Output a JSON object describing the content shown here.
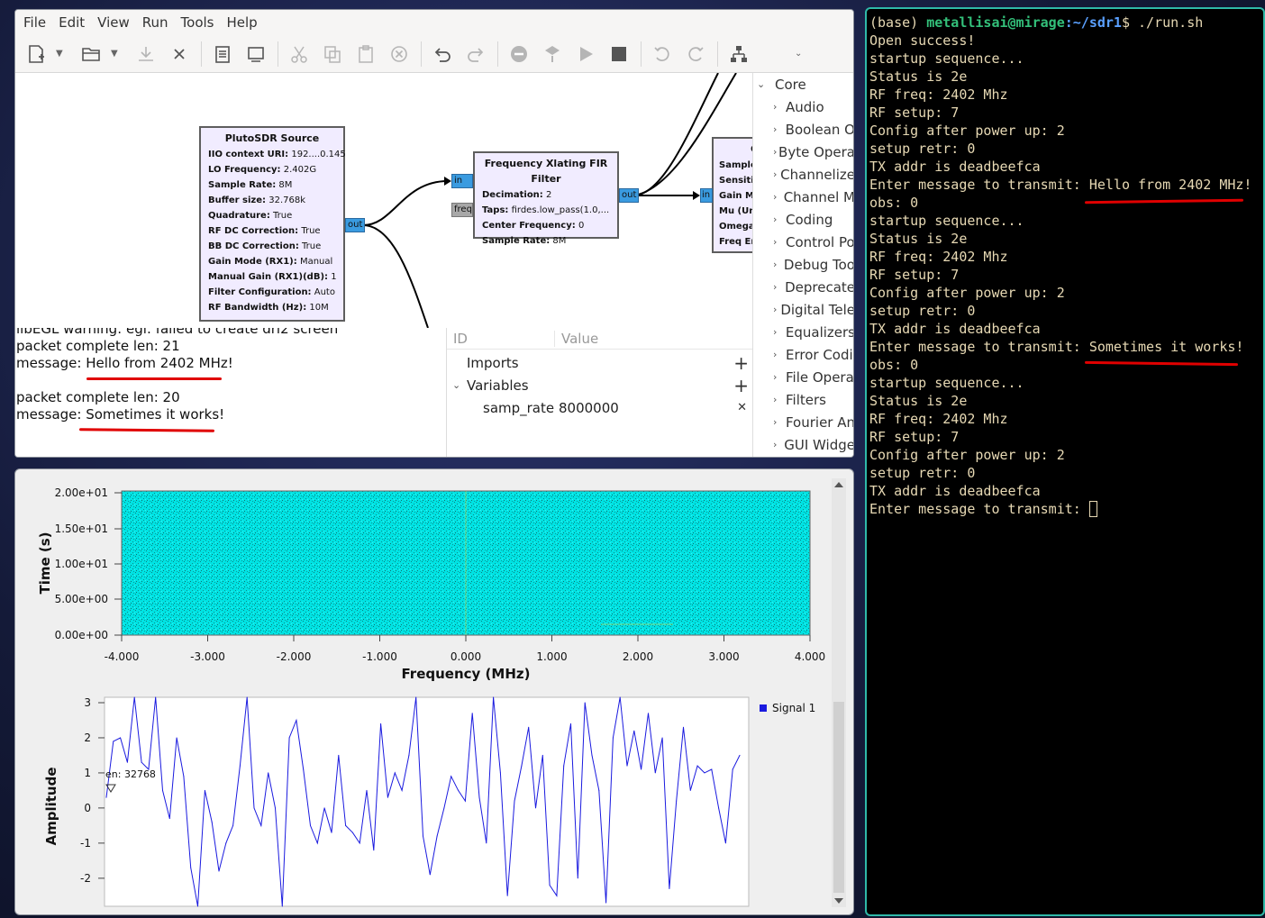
{
  "grc": {
    "menu": [
      "File",
      "Edit",
      "View",
      "Run",
      "Tools",
      "Help"
    ],
    "blocks": {
      "pluto": {
        "title": "PlutoSDR Source",
        "params": [
          {
            "k": "IIO context URI:",
            "v": "192....0.145"
          },
          {
            "k": "LO Frequency:",
            "v": "2.402G"
          },
          {
            "k": "Sample Rate:",
            "v": "8M"
          },
          {
            "k": "Buffer size:",
            "v": "32.768k"
          },
          {
            "k": "Quadrature:",
            "v": "True"
          },
          {
            "k": "RF DC Correction:",
            "v": "True"
          },
          {
            "k": "BB DC Correction:",
            "v": "True"
          },
          {
            "k": "Gain Mode (RX1):",
            "v": "Manual"
          },
          {
            "k": "Manual Gain (RX1)(dB):",
            "v": "1"
          },
          {
            "k": "Filter Configuration:",
            "v": "Auto"
          },
          {
            "k": "RF Bandwidth (Hz):",
            "v": "10M"
          }
        ],
        "out_port": "out"
      },
      "fir": {
        "title": "Frequency Xlating FIR Filter",
        "params": [
          {
            "k": "Decimation:",
            "v": "2"
          },
          {
            "k": "Taps:",
            "v": "firdes.low_pass(1.0,..."
          },
          {
            "k": "Center Frequency:",
            "v": "0"
          },
          {
            "k": "Sample Rate:",
            "v": "8M"
          }
        ],
        "in_port": "in",
        "freq_port": "freq",
        "out_port": "out"
      },
      "gfsk": {
        "title": "G",
        "params": [
          "Sample",
          "Sensitiv",
          "Gain Mu",
          "Mu (Un",
          "Omega",
          "Freq Err"
        ],
        "in_port": "in"
      }
    },
    "sidebar": {
      "root": "Core",
      "items": [
        "Audio",
        "Boolean O",
        "Byte Opera",
        "Channelize",
        "Channel M",
        "Coding",
        "Control Po",
        "Debug Too",
        "Deprecate",
        "Digital Tele",
        "Equalizers",
        "Error Codi",
        "File Opera",
        "Filters",
        "Fourier An",
        "GUI Widge"
      ]
    },
    "console": {
      "cut_line": "libEGL warning: egl: failed to create dri2 screen",
      "lines": [
        "packet complete len: 21",
        "message: Hello from 2402 MHz!",
        "",
        "packet complete len: 20",
        "message: Sometimes it works!"
      ]
    },
    "variables": {
      "col_id": "ID",
      "col_value": "Value",
      "imports": "Imports",
      "variables": "Variables",
      "var_name": "samp_rate",
      "var_value": "8000000"
    }
  },
  "qt": {
    "waterfall": {
      "ylabel": "Time (s)",
      "xlabel": "Frequency (MHz)",
      "yticks": [
        "2.00e+01",
        "1.50e+01",
        "1.00e+01",
        "5.00e+00",
        "0.00e+00"
      ],
      "xticks": [
        "-4.000",
        "-3.000",
        "-2.000",
        "-1.000",
        "0.000",
        "1.000",
        "2.000",
        "3.000",
        "4.000"
      ],
      "color": "#00e0e0"
    },
    "timeplot": {
      "ylabel": "Amplitude",
      "yticks": [
        "3",
        "2",
        "1",
        "0",
        "-1",
        "-2"
      ],
      "legend": "Signal 1",
      "marker_label": "en: 32768",
      "line_color": "#1a1adf"
    }
  },
  "chart_data": {
    "type": "line",
    "title": "",
    "xlabel": "",
    "ylabel": "Amplitude",
    "ylim": [
      -2.8,
      3
    ],
    "series": [
      {
        "name": "Signal 1",
        "values": [
          0.3,
          1.9,
          2.0,
          1.3,
          3.4,
          1.3,
          1.1,
          3.6,
          0.5,
          -0.3,
          2.0,
          0.9,
          -1.7,
          -3.2,
          0.5,
          -0.4,
          -1.8,
          -1.0,
          -0.5,
          1.2,
          3.5,
          0.0,
          -0.5,
          1.0,
          0.0,
          -3.0,
          2.0,
          2.5,
          1.1,
          -0.5,
          -1.0,
          0.0,
          -0.7,
          1.5,
          -0.5,
          -0.7,
          -1.0,
          0.5,
          -1.2,
          2.4,
          0.3,
          1.0,
          0.5,
          1.5,
          3.8,
          -0.8,
          -1.9,
          -0.8,
          0.0,
          0.9,
          0.5,
          0.2,
          2.7,
          0.3,
          -1.0,
          3.3,
          1.0,
          -2.5,
          0.2,
          1.2,
          2.3,
          0.0,
          1.5,
          -2.2,
          -2.5,
          1.2,
          2.4,
          -2.0,
          3.0,
          1.5,
          0.5,
          -2.7,
          2.0,
          3.4,
          1.2,
          2.2,
          1.1,
          2.7,
          1.0,
          2.0,
          -2.3,
          0.2,
          2.3,
          0.5,
          1.2,
          1.0,
          1.1,
          0.0,
          -1.0,
          1.1,
          1.5
        ]
      }
    ]
  },
  "terminal": {
    "prompt_prefix": "(base) ",
    "user_host": "metallisai@mirage",
    "path": ":~/sdr1",
    "command": "$ ./run.sh",
    "lines": [
      "Open success!",
      "startup sequence...",
      "Status is 2e",
      "RF freq: 2402 Mhz",
      "RF setup: 7",
      "Config after power up: 2",
      "setup retr: 0",
      "TX addr is deadbeefca",
      "Enter message to transmit: Hello from 2402 MHz!",
      "obs: 0",
      "startup sequence...",
      "Status is 2e",
      "RF freq: 2402 Mhz",
      "RF setup: 7",
      "Config after power up: 2",
      "setup retr: 0",
      "TX addr is deadbeefca",
      "Enter message to transmit: Sometimes it works!",
      "obs: 0",
      "startup sequence...",
      "Status is 2e",
      "RF freq: 2402 Mhz",
      "RF setup: 7",
      "Config after power up: 2",
      "setup retr: 0",
      "TX addr is deadbeefca",
      "Enter message to transmit: "
    ]
  }
}
